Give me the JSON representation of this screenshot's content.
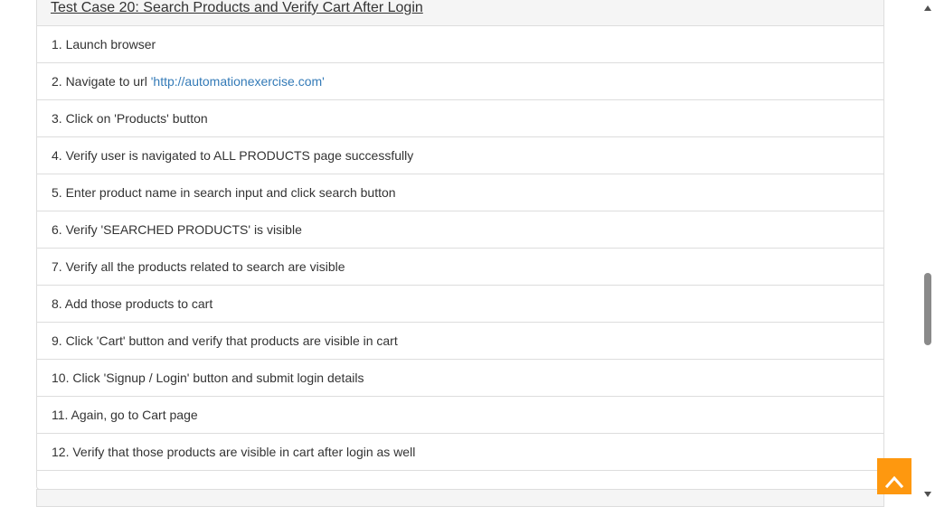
{
  "test_case": {
    "title": "Test Case 20: Search Products and Verify Cart After Login",
    "steps": [
      {
        "text": "1. Launch browser"
      },
      {
        "text": "2. Navigate to url ",
        "link": "'http://automationexercise.com'"
      },
      {
        "text": "3. Click on 'Products' button"
      },
      {
        "text": "4. Verify user is navigated to ALL PRODUCTS page successfully"
      },
      {
        "text": "5. Enter product name in search input and click search button"
      },
      {
        "text": "6. Verify 'SEARCHED PRODUCTS' is visible"
      },
      {
        "text": "7. Verify all the products related to search are visible"
      },
      {
        "text": "8. Add those products to cart"
      },
      {
        "text": "9. Click 'Cart' button and verify that products are visible in cart"
      },
      {
        "text": "10. Click 'Signup / Login' button and submit login details"
      },
      {
        "text": "11. Again, go to Cart page"
      },
      {
        "text": "12. Verify that those products are visible in cart after login as well"
      }
    ]
  },
  "scroll_to_top_button": {
    "icon": "chevron-up-icon"
  },
  "colors": {
    "accent": "#FE980F",
    "link": "#337AB7"
  }
}
